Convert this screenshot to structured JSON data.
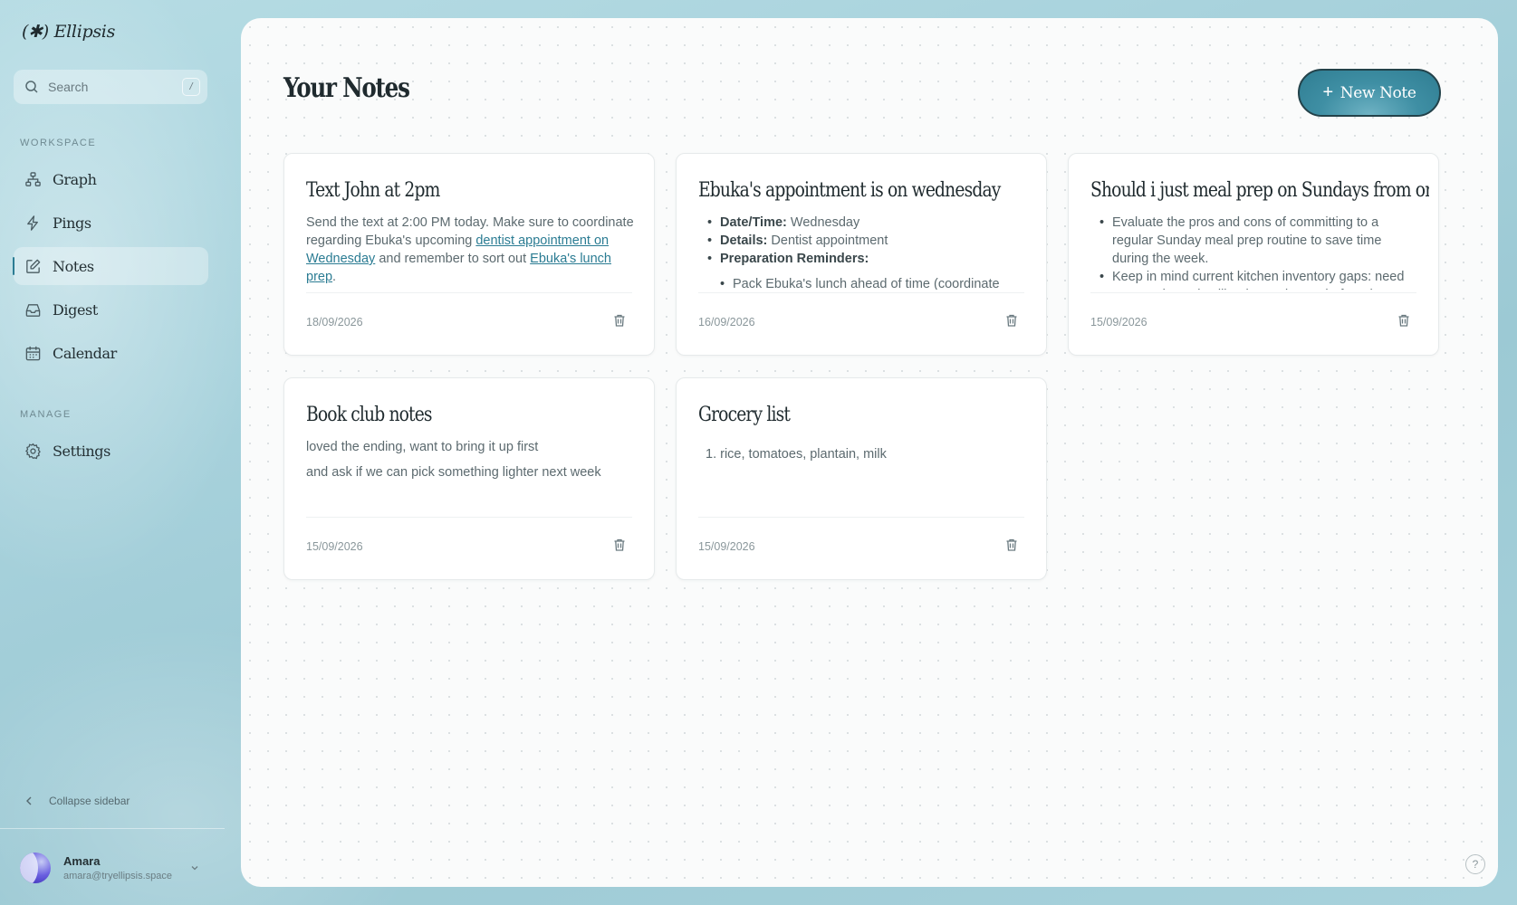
{
  "app": {
    "logo": "(✱) Ellipsis"
  },
  "search": {
    "placeholder": "Search",
    "shortcut": "/"
  },
  "sidebar": {
    "workspace_label": "WORKSPACE",
    "manage_label": "MANAGE",
    "items": [
      {
        "label": "Graph",
        "icon": "graph-icon"
      },
      {
        "label": "Pings",
        "icon": "lightning-icon"
      },
      {
        "label": "Notes",
        "icon": "edit-icon",
        "active": true
      },
      {
        "label": "Digest",
        "icon": "inbox-icon"
      },
      {
        "label": "Calendar",
        "icon": "calendar-icon"
      }
    ],
    "manage_items": [
      {
        "label": "Settings",
        "icon": "gear-icon"
      }
    ],
    "collapse_label": "Collapse sidebar"
  },
  "user": {
    "name": "Amara",
    "email": "amara@tryellipsis.space"
  },
  "main": {
    "title": "Your Notes",
    "new_note_label": "New Note"
  },
  "notes": [
    {
      "title": "Text John at 2pm",
      "body_parts": {
        "t1": "Send the text at 2:00 PM today. Make sure to coordinate regarding Ebuka's upcoming ",
        "l1": "dentist appointment on Wednesday",
        "t2": " and remember to sort out ",
        "l2": "Ebuka's lunch prep",
        "t3": "."
      },
      "date": "18/09/2026"
    },
    {
      "title": "Ebuka's appointment is on wednesday",
      "bullets": [
        {
          "bold": "Date/Time:",
          "text": " Wednesday"
        },
        {
          "bold": "Details:",
          "text": " Dentist appointment"
        },
        {
          "bold": "Preparation Reminders:",
          "text": ""
        }
      ],
      "sub_bullet": "Pack Ebuka's lunch ahead of time (coordinate",
      "date": "16/09/2026"
    },
    {
      "title": "Should i just meal prep on Sundays from on",
      "bullets": [
        "Evaluate the pros and cons of committing to a regular Sunday meal prep routine to save time during the week.",
        "Keep in mind current kitchen inventory gaps: need to restock staples like rice and more before the"
      ],
      "date": "15/09/2026"
    },
    {
      "title": "Book club notes",
      "lines": [
        "loved the ending, want to bring it up first",
        "and ask if we can pick something lighter next week"
      ],
      "date": "15/09/2026"
    },
    {
      "title": "Grocery list",
      "ordered": [
        "rice, tomatoes, plantain, milk"
      ],
      "date": "15/09/2026"
    }
  ],
  "help_label": "?"
}
